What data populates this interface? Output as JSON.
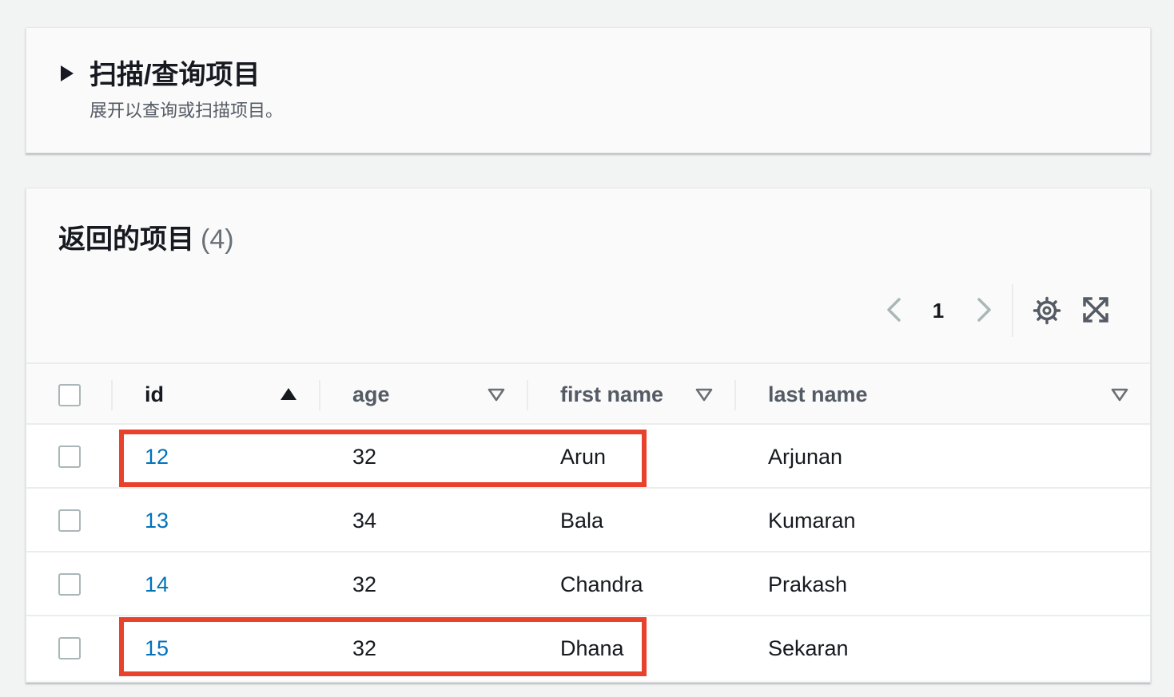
{
  "scan_panel": {
    "title": "扫描/查询项目",
    "description": "展开以查询或扫描项目。"
  },
  "results": {
    "title": "返回的项目",
    "count": "(4)",
    "pagination": {
      "current_page": "1"
    },
    "columns": [
      {
        "label": "id",
        "sort": "ascending"
      },
      {
        "label": "age",
        "sort": "none"
      },
      {
        "label": "first name",
        "sort": "none"
      },
      {
        "label": "last name",
        "sort": "none"
      }
    ],
    "rows": [
      {
        "id": "12",
        "age": "32",
        "first_name": "Arun",
        "last_name": "Arjunan",
        "highlighted": true
      },
      {
        "id": "13",
        "age": "34",
        "first_name": "Bala",
        "last_name": "Kumaran",
        "highlighted": false
      },
      {
        "id": "14",
        "age": "32",
        "first_name": "Chandra",
        "last_name": "Prakash",
        "highlighted": false
      },
      {
        "id": "15",
        "age": "32",
        "first_name": "Dhana",
        "last_name": "Sekaran",
        "highlighted": true
      }
    ]
  },
  "colors": {
    "link": "#0073bb",
    "highlight": "#e8412c",
    "text": "#16191f",
    "muted": "#545b64"
  },
  "icons": {
    "expand": "caret-right-icon",
    "prev": "chevron-left-icon",
    "next": "chevron-right-icon",
    "settings": "gear-icon",
    "fullscreen": "fullscreen-icon",
    "sort_ascending": "sort-ascending-icon",
    "sort_none": "sort-caret-down-icon"
  }
}
